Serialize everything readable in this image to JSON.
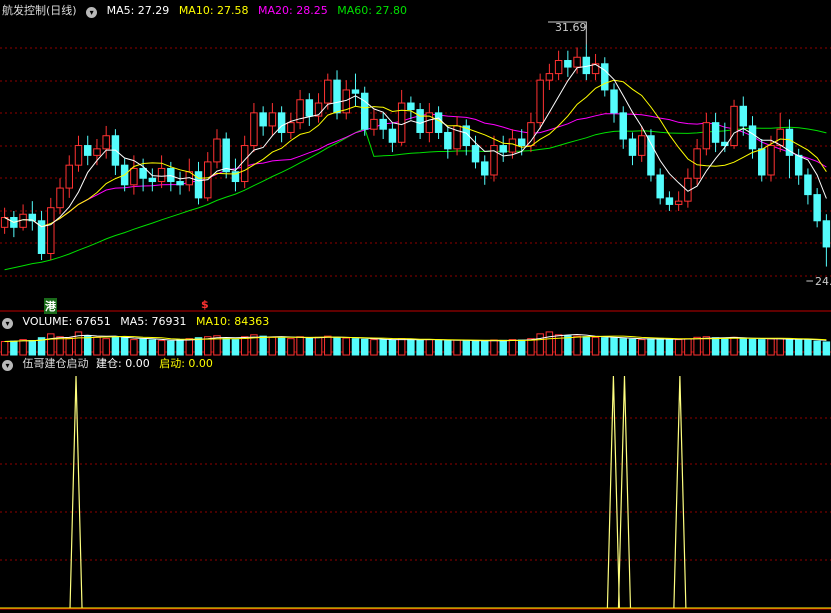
{
  "colors": {
    "up": "#ff3232",
    "down": "#54fcfc",
    "ma5": "#ffffff",
    "ma10": "#ffff00",
    "ma20": "#ff00ff",
    "ma60": "#00e000",
    "grid": "#900000",
    "border": "#c00000"
  },
  "price_panel": {
    "title": "航发控制(日线)",
    "ma5_label": "MA5: 27.29",
    "ma10_label": "MA10: 27.58",
    "ma20_label": "MA20: 28.25",
    "ma60_label": "MA60: 27.80",
    "high_label": "31.69",
    "low_label": "24.",
    "marker_gang": "港",
    "marker_dollar": "$"
  },
  "volume_panel": {
    "vol_label": "VOLUME: 67651",
    "ma5_label": "MA5: 76931",
    "ma10_label": "MA10: 84363"
  },
  "indicator_panel": {
    "title": "伍哥建仓启动",
    "jiancang_label": "建仓: 0.00",
    "qidong_label": "启动: 0.00"
  },
  "chart_data": {
    "type": "candlestick",
    "bar_count": 90,
    "ylim": [
      24,
      32.5
    ],
    "high": 31.69,
    "ma_last": {
      "MA5": 27.29,
      "MA10": 27.58,
      "MA20": 28.25,
      "MA60": 27.8
    },
    "candles": [
      [
        26.1,
        26.4,
        26.7,
        25.9
      ],
      [
        26.4,
        26.1,
        26.6,
        25.8
      ],
      [
        26.1,
        26.5,
        26.8,
        26.0
      ],
      [
        26.5,
        26.3,
        26.9,
        26.0
      ],
      [
        26.3,
        25.3,
        26.6,
        25.1
      ],
      [
        25.3,
        26.7,
        27.0,
        25.1
      ],
      [
        26.7,
        27.3,
        27.6,
        26.5
      ],
      [
        27.3,
        28.0,
        28.3,
        27.0
      ],
      [
        28.0,
        28.6,
        28.9,
        27.8
      ],
      [
        28.6,
        28.3,
        28.9,
        28.0
      ],
      [
        28.3,
        28.5,
        28.8,
        28.0
      ],
      [
        28.5,
        28.9,
        29.2,
        28.2
      ],
      [
        28.9,
        28.0,
        29.1,
        27.7
      ],
      [
        28.0,
        27.4,
        28.2,
        27.2
      ],
      [
        27.4,
        27.9,
        28.3,
        27.1
      ],
      [
        27.9,
        27.6,
        28.2,
        27.2
      ],
      [
        27.6,
        27.5,
        27.9,
        27.2
      ],
      [
        27.5,
        27.9,
        28.3,
        27.3
      ],
      [
        27.9,
        27.5,
        28.1,
        27.2
      ],
      [
        27.5,
        27.4,
        27.8,
        27.1
      ],
      [
        27.4,
        27.8,
        28.2,
        27.2
      ],
      [
        27.8,
        27.0,
        28.1,
        26.8
      ],
      [
        27.0,
        28.1,
        28.4,
        26.9
      ],
      [
        28.1,
        28.8,
        29.1,
        27.9
      ],
      [
        28.8,
        27.8,
        29.0,
        27.6
      ],
      [
        27.8,
        27.5,
        28.2,
        27.2
      ],
      [
        27.5,
        28.6,
        28.9,
        27.3
      ],
      [
        28.6,
        29.6,
        29.9,
        28.4
      ],
      [
        29.6,
        29.2,
        29.8,
        28.9
      ],
      [
        29.2,
        29.6,
        29.9,
        28.9
      ],
      [
        29.6,
        29.0,
        29.8,
        28.7
      ],
      [
        29.0,
        29.3,
        29.6,
        28.8
      ],
      [
        29.3,
        30.0,
        30.3,
        29.1
      ],
      [
        30.0,
        29.5,
        30.2,
        29.2
      ],
      [
        29.5,
        29.9,
        30.2,
        29.3
      ],
      [
        29.9,
        30.6,
        30.8,
        29.7
      ],
      [
        30.6,
        29.6,
        30.9,
        29.4
      ],
      [
        29.6,
        30.3,
        30.6,
        29.4
      ],
      [
        30.3,
        30.2,
        30.8,
        29.8
      ],
      [
        30.2,
        29.1,
        30.4,
        28.9
      ],
      [
        29.1,
        29.4,
        29.7,
        28.9
      ],
      [
        29.4,
        29.1,
        29.6,
        28.8
      ],
      [
        29.1,
        28.7,
        29.3,
        28.4
      ],
      [
        28.7,
        29.9,
        30.3,
        28.6
      ],
      [
        29.9,
        29.7,
        30.1,
        29.4
      ],
      [
        29.7,
        29.0,
        29.9,
        28.8
      ],
      [
        29.0,
        29.6,
        29.9,
        28.7
      ],
      [
        29.6,
        29.0,
        29.8,
        28.8
      ],
      [
        29.0,
        28.5,
        29.2,
        28.2
      ],
      [
        28.5,
        29.2,
        29.5,
        28.3
      ],
      [
        29.2,
        28.6,
        29.4,
        28.3
      ],
      [
        28.6,
        28.1,
        28.9,
        27.9
      ],
      [
        28.1,
        27.7,
        28.3,
        27.4
      ],
      [
        27.7,
        28.6,
        28.9,
        27.5
      ],
      [
        28.6,
        28.4,
        28.9,
        28.1
      ],
      [
        28.4,
        28.8,
        29.1,
        28.2
      ],
      [
        28.8,
        28.6,
        29.1,
        28.3
      ],
      [
        28.6,
        29.3,
        29.6,
        28.4
      ],
      [
        29.3,
        30.6,
        30.8,
        29.1
      ],
      [
        30.6,
        30.8,
        31.1,
        30.3
      ],
      [
        30.8,
        31.2,
        31.5,
        30.6
      ],
      [
        31.2,
        31.0,
        31.5,
        30.7
      ],
      [
        31.0,
        31.3,
        31.6,
        30.8
      ],
      [
        31.3,
        30.8,
        31.69,
        30.6
      ],
      [
        30.8,
        31.1,
        31.4,
        30.6
      ],
      [
        31.1,
        30.3,
        31.3,
        30.1
      ],
      [
        30.3,
        29.6,
        30.5,
        29.3
      ],
      [
        29.6,
        28.8,
        29.8,
        28.5
      ],
      [
        28.8,
        28.3,
        29.0,
        28.0
      ],
      [
        28.3,
        28.9,
        29.2,
        28.1
      ],
      [
        28.9,
        27.7,
        29.1,
        27.5
      ],
      [
        27.7,
        27.0,
        27.9,
        26.8
      ],
      [
        27.0,
        26.8,
        27.2,
        26.6
      ],
      [
        26.8,
        26.9,
        27.2,
        26.6
      ],
      [
        26.9,
        27.6,
        27.9,
        26.7
      ],
      [
        27.6,
        28.5,
        28.8,
        27.4
      ],
      [
        28.5,
        29.3,
        29.6,
        28.3
      ],
      [
        29.3,
        28.7,
        29.6,
        28.4
      ],
      [
        28.7,
        28.6,
        29.3,
        28.4
      ],
      [
        28.6,
        29.8,
        30.0,
        28.5
      ],
      [
        29.8,
        29.2,
        30.1,
        28.9
      ],
      [
        29.2,
        28.5,
        29.5,
        28.2
      ],
      [
        28.5,
        27.7,
        28.8,
        27.5
      ],
      [
        27.7,
        28.6,
        28.9,
        27.5
      ],
      [
        28.6,
        29.1,
        29.6,
        28.4
      ],
      [
        29.1,
        28.3,
        29.4,
        27.6
      ],
      [
        28.3,
        27.7,
        28.5,
        27.4
      ],
      [
        27.7,
        27.1,
        27.9,
        26.8
      ],
      [
        27.1,
        26.3,
        27.3,
        26.1
      ],
      [
        26.3,
        25.5,
        26.5,
        24.9
      ]
    ],
    "volume": [
      70,
      72,
      80,
      75,
      90,
      110,
      95,
      88,
      120,
      100,
      92,
      85,
      95,
      90,
      80,
      82,
      78,
      75,
      72,
      80,
      85,
      90,
      95,
      100,
      85,
      80,
      95,
      105,
      98,
      92,
      88,
      85,
      95,
      90,
      92,
      98,
      90,
      88,
      85,
      82,
      80,
      78,
      76,
      85,
      82,
      78,
      80,
      76,
      74,
      78,
      75,
      72,
      70,
      78,
      76,
      80,
      78,
      85,
      110,
      120,
      105,
      100,
      98,
      95,
      92,
      90,
      88,
      85,
      82,
      80,
      84,
      86,
      82,
      80,
      84,
      92,
      95,
      90,
      88,
      92,
      86,
      82,
      80,
      84,
      86,
      82,
      80,
      78,
      72,
      68
    ],
    "indicator_spikes": [
      13,
      110,
      112,
      122
    ]
  }
}
